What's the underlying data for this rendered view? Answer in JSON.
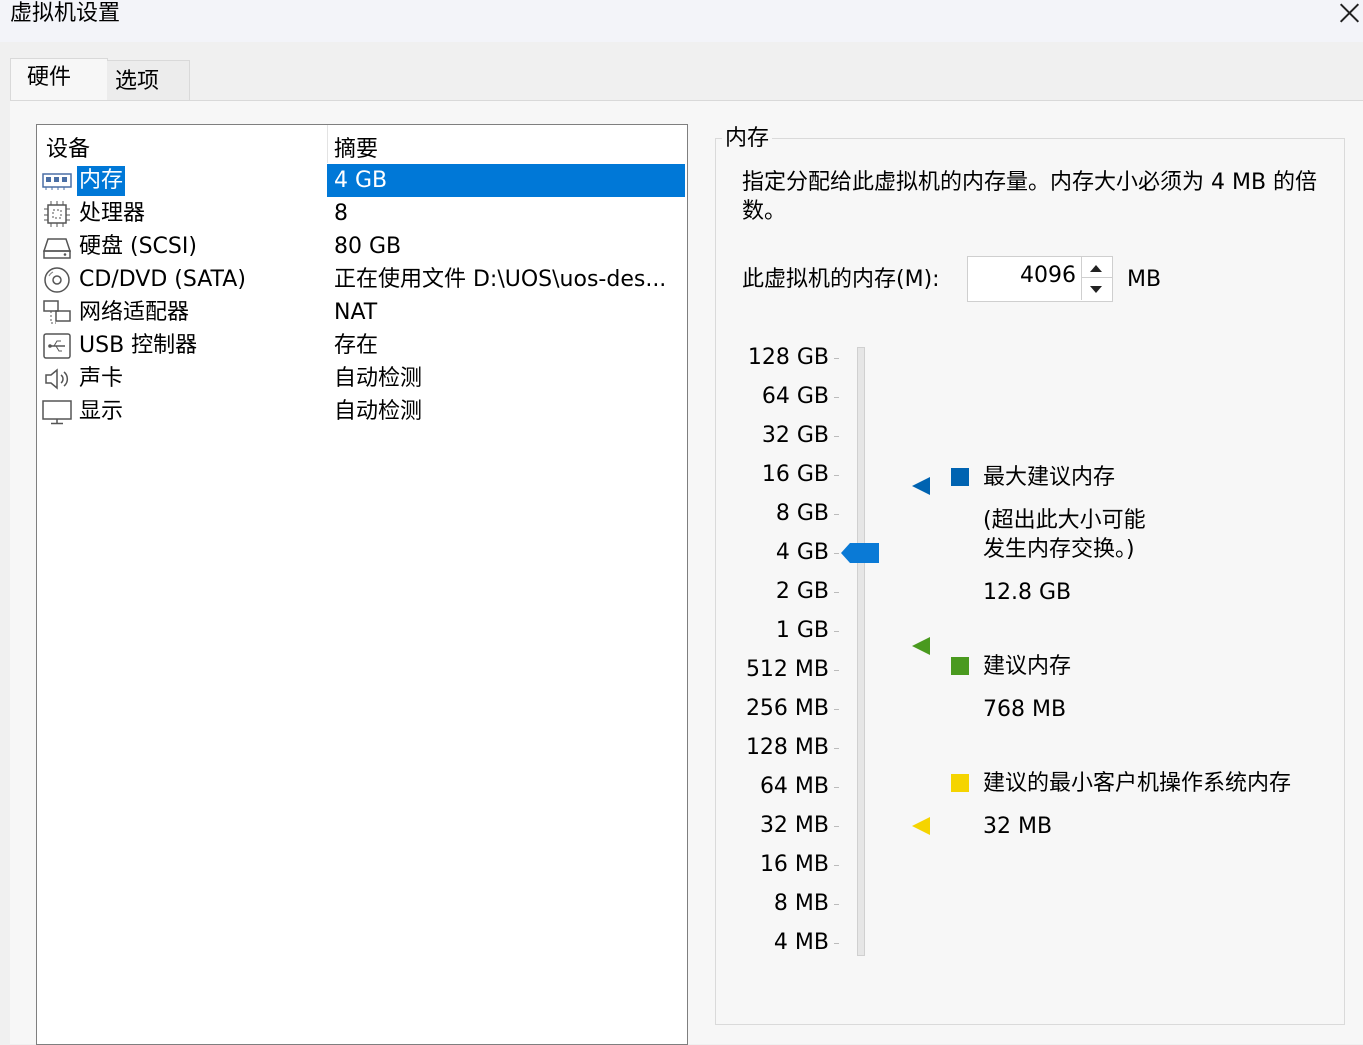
{
  "window": {
    "title": "虚拟机设置"
  },
  "tabs": [
    {
      "label": "硬件"
    },
    {
      "label": "选项"
    }
  ],
  "device_list": {
    "headers": {
      "device": "设备",
      "summary": "摘要"
    },
    "rows": [
      {
        "icon": "memory-icon",
        "name": "内存",
        "summary": "4 GB"
      },
      {
        "icon": "processor-icon",
        "name": "处理器",
        "summary": "8"
      },
      {
        "icon": "hard-disk-icon",
        "name": "硬盘 (SCSI)",
        "summary": "80 GB"
      },
      {
        "icon": "cd-dvd-icon",
        "name": "CD/DVD (SATA)",
        "summary": "正在使用文件 D:\\UOS\\uos-des..."
      },
      {
        "icon": "network-adapter-icon",
        "name": "网络适配器",
        "summary": "NAT"
      },
      {
        "icon": "usb-icon",
        "name": "USB 控制器",
        "summary": "存在"
      },
      {
        "icon": "sound-card-icon",
        "name": "声卡",
        "summary": "自动检测"
      },
      {
        "icon": "display-icon",
        "name": "显示",
        "summary": "自动检测"
      }
    ],
    "selected": "内存"
  },
  "memory": {
    "group_label": "内存",
    "description": "指定分配给此虚拟机的内存量。内存大小必须为 4 MB 的倍数。",
    "input_label": "此虚拟机的内存(M):",
    "value": "4096",
    "unit": "MB",
    "scale": [
      "128 GB",
      "64 GB",
      "32 GB",
      "16 GB",
      "8 GB",
      "4 GB",
      "2 GB",
      "1 GB",
      "512 MB",
      "256 MB",
      "128 MB",
      "64 MB",
      "32 MB",
      "16 MB",
      "8 MB",
      "4 MB"
    ],
    "slider_value": "4 GB",
    "legend": {
      "max": {
        "title": "最大建议内存",
        "note_line1": "(超出此大小可能",
        "note_line2": "发生内存交换。)",
        "value": "12.8 GB",
        "color": "#0063b1"
      },
      "recommended": {
        "title": "建议内存",
        "value": "768 MB",
        "color": "#4a9a1f"
      },
      "min_guest": {
        "title": "建议的最小客户机操作系统内存",
        "value": "32 MB",
        "color": "#f5d400"
      }
    }
  }
}
